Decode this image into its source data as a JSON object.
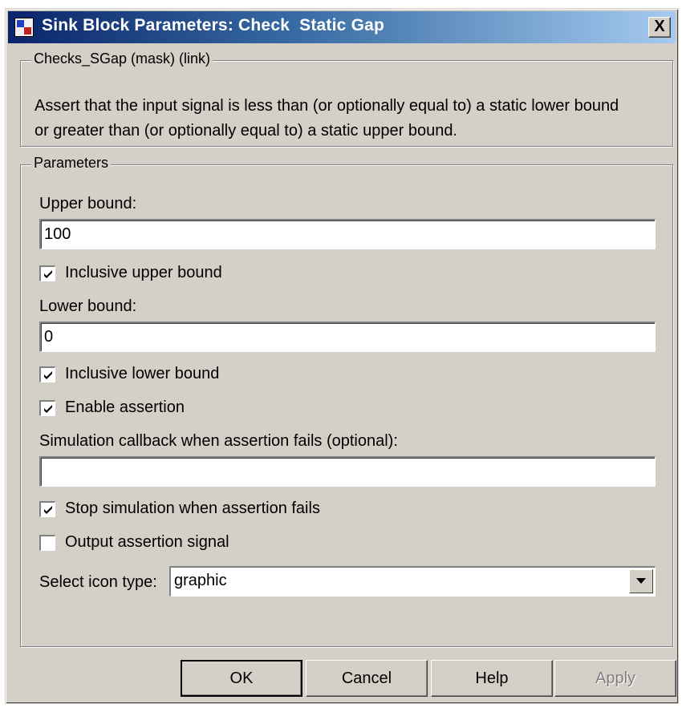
{
  "window": {
    "title": "Sink Block Parameters: Check  Static Gap",
    "close_label": "X"
  },
  "mask": {
    "legend": "Checks_SGap (mask) (link)",
    "description_line1": "Assert that the input signal is less than (or optionally equal to) a static lower bound",
    "description_line2": "or greater than (or optionally equal to) a static upper bound."
  },
  "parameters": {
    "legend": "Parameters",
    "upper_bound_label": "Upper bound:",
    "upper_bound_value": "100",
    "inclusive_upper_label": "Inclusive upper bound",
    "inclusive_upper_checked": true,
    "lower_bound_label": "Lower bound:",
    "lower_bound_value": "0",
    "inclusive_lower_label": "Inclusive lower bound",
    "inclusive_lower_checked": true,
    "enable_assertion_label": "Enable assertion",
    "enable_assertion_checked": true,
    "callback_label": "Simulation callback when assertion fails (optional):",
    "callback_value": "",
    "stop_sim_label": "Stop simulation when assertion fails",
    "stop_sim_checked": true,
    "output_signal_label": "Output assertion signal",
    "output_signal_checked": false,
    "icon_type_label": "Select icon type:",
    "icon_type_value": "graphic"
  },
  "buttons": {
    "ok": "OK",
    "cancel": "Cancel",
    "help": "Help",
    "apply": "Apply"
  }
}
